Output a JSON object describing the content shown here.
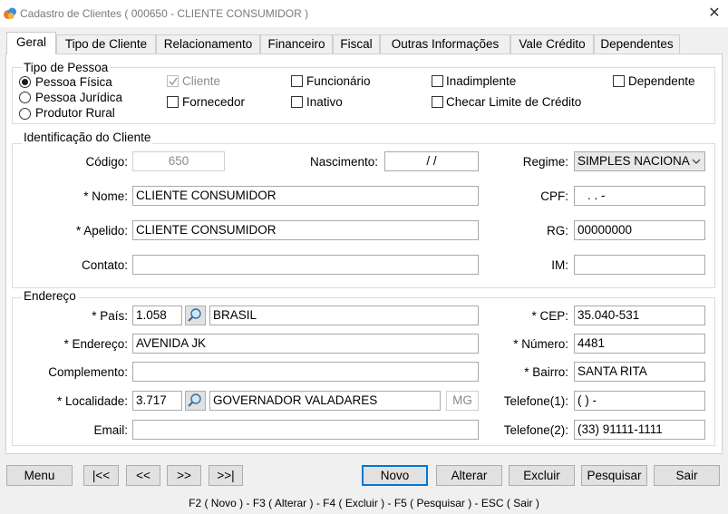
{
  "window": {
    "title": "Cadastro de Clientes ( 000650 - CLIENTE CONSUMIDOR )",
    "close_glyph": "✕"
  },
  "tabs": [
    {
      "label": "Geral",
      "active": true
    },
    {
      "label": "Tipo de Cliente"
    },
    {
      "label": "Relacionamento"
    },
    {
      "label": "Financeiro"
    },
    {
      "label": "Fiscal"
    },
    {
      "label": "Outras Informações"
    },
    {
      "label": "Vale Crédito"
    },
    {
      "label": "Dependentes"
    }
  ],
  "tipo_pessoa": {
    "legend": "Tipo de Pessoa",
    "radios": [
      {
        "label": "Pessoa Física",
        "selected": true
      },
      {
        "label": "Pessoa Jurídica",
        "selected": false
      },
      {
        "label": "Produtor Rural",
        "selected": false
      }
    ],
    "checkboxes": {
      "cliente": {
        "label": "Cliente",
        "checked": true,
        "disabled": true
      },
      "fornecedor": {
        "label": "Fornecedor",
        "checked": false
      },
      "funcionario": {
        "label": "Funcionário",
        "checked": false
      },
      "inativo": {
        "label": "Inativo",
        "checked": false
      },
      "inadimplente": {
        "label": "Inadimplente",
        "checked": false
      },
      "checar_limite": {
        "label": "Checar Limite de Crédito",
        "checked": false
      },
      "dependente": {
        "label": "Dependente",
        "checked": false
      }
    }
  },
  "identificacao": {
    "legend": "Identificação do Cliente",
    "codigo": {
      "label": "Código:",
      "value": "650"
    },
    "nascimento": {
      "label": "Nascimento:",
      "value": "/ /"
    },
    "regime": {
      "label": "Regime:",
      "value": "SIMPLES NACIONA"
    },
    "nome": {
      "label": "* Nome:",
      "value": "CLIENTE CONSUMIDOR"
    },
    "cpf": {
      "label": "CPF:",
      "value": ".   .   -"
    },
    "apelido": {
      "label": "* Apelido:",
      "value": "CLIENTE CONSUMIDOR"
    },
    "rg": {
      "label": "RG:",
      "value": "00000000"
    },
    "contato": {
      "label": "Contato:",
      "value": ""
    },
    "im": {
      "label": "IM:",
      "value": ""
    }
  },
  "endereco": {
    "legend": "Endereço",
    "pais": {
      "label": "* País:",
      "code": "1.058",
      "name": "BRASIL"
    },
    "cep": {
      "label": "* CEP:",
      "value": "35.040-531"
    },
    "endereco": {
      "label": "* Endereço:",
      "value": "AVENIDA JK"
    },
    "numero": {
      "label": "* Número:",
      "value": "4481"
    },
    "complemento": {
      "label": "Complemento:",
      "value": ""
    },
    "bairro": {
      "label": "* Bairro:",
      "value": "SANTA RITA"
    },
    "localidade": {
      "label": "* Localidade:",
      "code": "3.717",
      "name": "GOVERNADOR VALADARES",
      "uf": "MG"
    },
    "telefone1": {
      "label": "Telefone(1):",
      "value": "(  )       -"
    },
    "email": {
      "label": "Email:",
      "value": ""
    },
    "telefone2": {
      "label": "Telefone(2):",
      "value": "(33) 91111-1111"
    }
  },
  "buttons": {
    "menu": "Menu",
    "first": "|<<",
    "prev": "<<",
    "next": ">>",
    "last": ">>|",
    "novo": "Novo",
    "alterar": "Alterar",
    "excluir": "Excluir",
    "pesquisar": "Pesquisar",
    "sair": "Sair"
  },
  "shortcuts": "F2 ( Novo )  -  F3 ( Alterar )  -  F4 ( Excluir )  -  F5 ( Pesquisar )  -  ESC ( Sair )",
  "colors": {
    "accent": "#0078d7",
    "panel": "#ffffff",
    "window_bg": "#f0f0f0"
  }
}
